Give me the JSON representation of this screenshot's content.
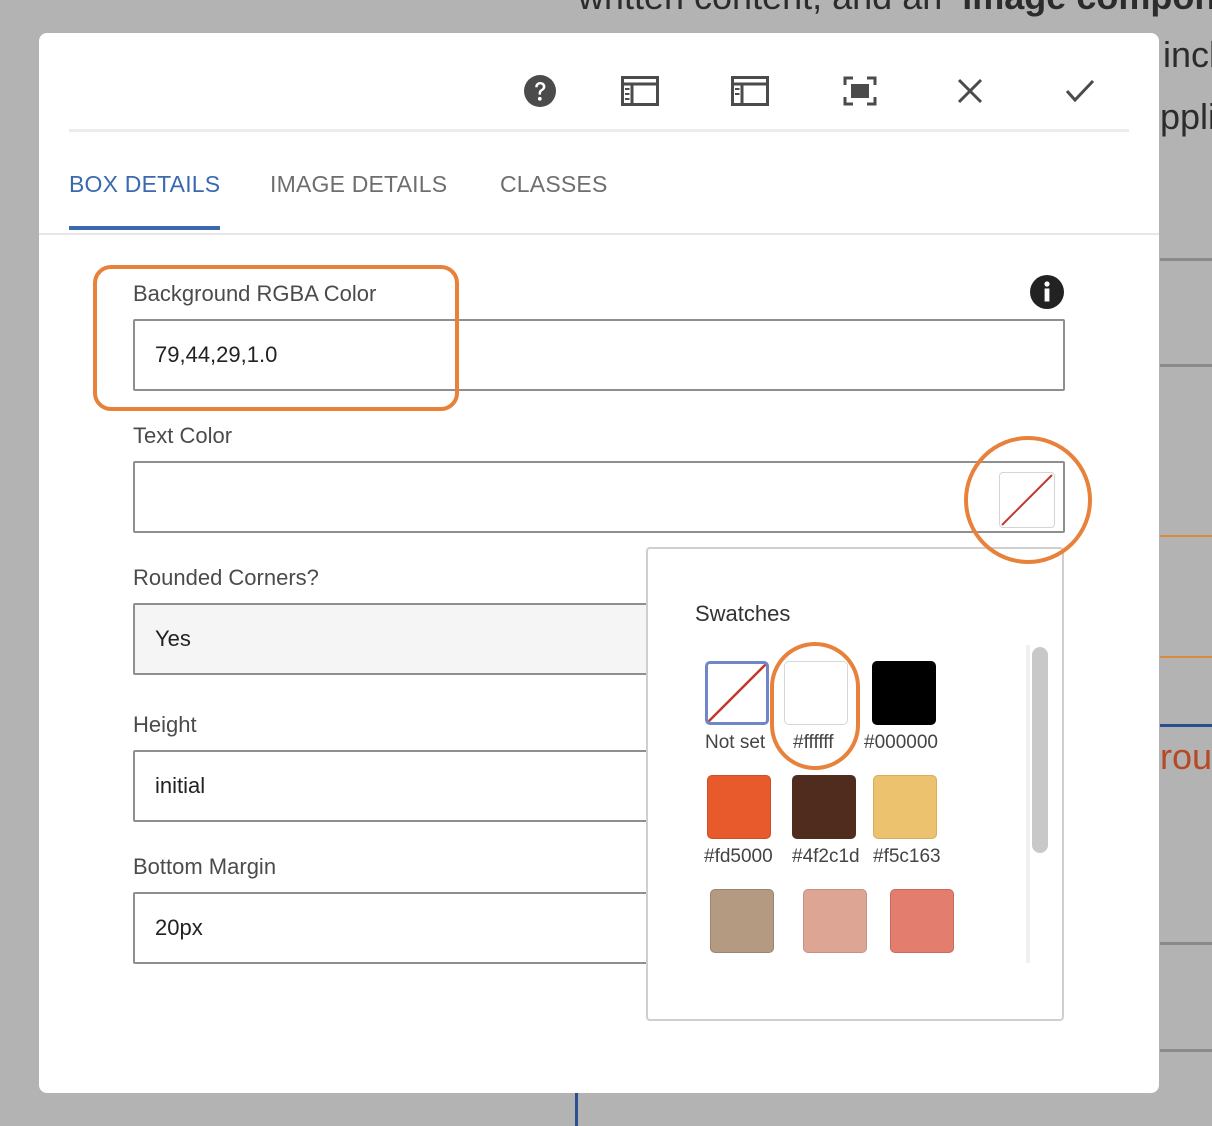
{
  "background_page": {
    "fragments": [
      "written content, and an",
      "image componen",
      "incl",
      "ppli",
      "rou"
    ]
  },
  "toolbar": {
    "icons": [
      "help-icon",
      "sidebar-left-icon",
      "sidebar-panel-icon",
      "fullscreen-icon",
      "close-icon",
      "check-icon"
    ]
  },
  "tabs": [
    {
      "label": "BOX DETAILS",
      "active": true
    },
    {
      "label": "IMAGE DETAILS",
      "active": false
    },
    {
      "label": "CLASSES",
      "active": false
    }
  ],
  "form": {
    "bg_color": {
      "label": "Background RGBA Color",
      "value": "79,44,29,1.0"
    },
    "text_color": {
      "label": "Text Color",
      "value": ""
    },
    "rounded": {
      "label": "Rounded Corners?",
      "value": "Yes"
    },
    "height": {
      "label": "Height",
      "value": "initial"
    },
    "bottom_margin": {
      "label": "Bottom Margin",
      "value": "20px"
    }
  },
  "swatches": {
    "title": "Swatches",
    "items": [
      {
        "label": "Not set",
        "color": "#ffffff",
        "not_set": true
      },
      {
        "label": "#ffffff",
        "color": "#ffffff"
      },
      {
        "label": "#000000",
        "color": "#000000"
      },
      {
        "label": "#fd5000",
        "color": "#e85a2c"
      },
      {
        "label": "#4f2c1d",
        "color": "#4f2c1d"
      },
      {
        "label": "#f5c163",
        "color": "#ecc26e"
      },
      {
        "label": "",
        "color": "#b39a80"
      },
      {
        "label": "",
        "color": "#dca594"
      },
      {
        "label": "",
        "color": "#e37e6e"
      }
    ]
  },
  "colors": {
    "accent": "#3b69b0",
    "highlight": "#e8813a"
  }
}
